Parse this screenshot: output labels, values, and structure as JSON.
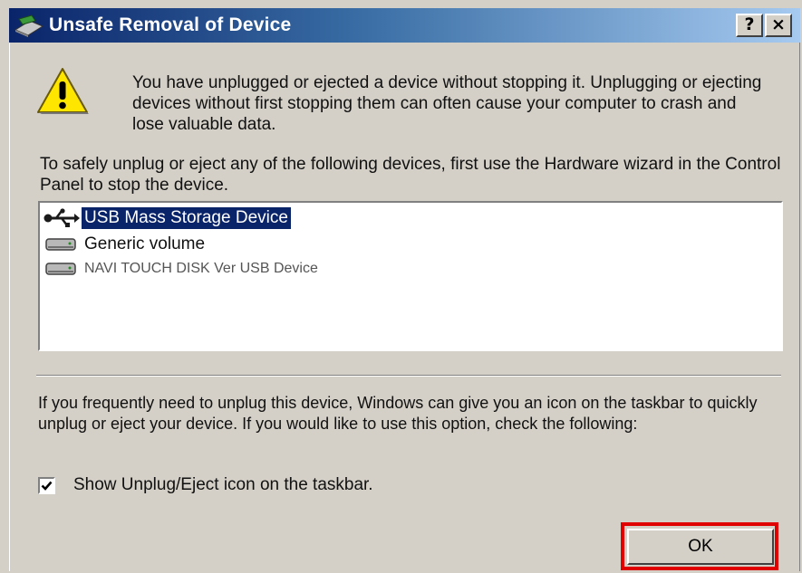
{
  "window": {
    "title": "Unsafe Removal of Device",
    "help_button": "?",
    "close_button": "×"
  },
  "message": "You have unplugged or ejected a device without stopping it. Unplugging or ejecting devices without first stopping them can often cause your computer to crash and lose valuable data.",
  "instruction": "To safely unplug or eject any of the following devices, first use the Hardware wizard in the Control Panel to stop the device.",
  "devices": [
    {
      "label": "USB Mass Storage Device",
      "icon": "usb-icon",
      "selected": true
    },
    {
      "label": "Generic volume",
      "icon": "drive-icon",
      "selected": false
    },
    {
      "label": "NAVI TOUCH DISK Ver USB Device",
      "icon": "drive-icon",
      "selected": false
    }
  ],
  "info": "If you frequently need to unplug this device, Windows can give you an icon on the taskbar to quickly unplug or eject your device. If you would like to use this option, check the following:",
  "checkbox": {
    "label": "Show Unplug/Eject icon on the taskbar.",
    "checked": true
  },
  "ok_label": "OK",
  "colors": {
    "title_gradient_start": "#0a246a",
    "title_gradient_end": "#a6caf0",
    "dialog_background": "#d4d0c8",
    "selection": "#0a246a",
    "highlight_box": "#e00000"
  }
}
